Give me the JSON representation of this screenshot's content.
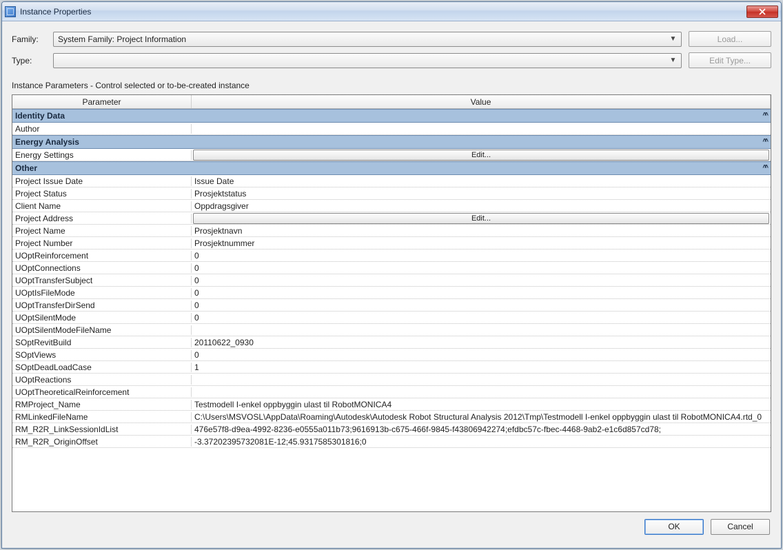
{
  "window": {
    "title": "Instance Properties"
  },
  "labels": {
    "family": "Family:",
    "type": "Type:",
    "load": "Load...",
    "edit_type": "Edit Type...",
    "subhead": "Instance Parameters - Control selected or to-be-created instance",
    "col_param": "Parameter",
    "col_value": "Value",
    "edit_btn": "Edit...",
    "ok": "OK",
    "cancel": "Cancel"
  },
  "family_value": "System Family: Project Information",
  "type_value": "",
  "groups": {
    "identity": "Identity Data",
    "energy": "Energy Analysis",
    "other": "Other"
  },
  "rows": {
    "author_p": "Author",
    "author_v": "",
    "energy_p": "Energy Settings",
    "pid_p": "Project Issue Date",
    "pid_v": "Issue Date",
    "pstatus_p": "Project Status",
    "pstatus_v": "Prosjektstatus",
    "client_p": "Client Name",
    "client_v": "Oppdragsgiver",
    "paddr_p": "Project Address",
    "pname_p": "Project Name",
    "pname_v": "Prosjektnavn",
    "pnum_p": "Project Number",
    "pnum_v": "Prosjektnummer",
    "ureinf_p": "UOptReinforcement",
    "ureinf_v": "0",
    "uconn_p": "UOptConnections",
    "uconn_v": "0",
    "utsub_p": "UOptTransferSubject",
    "utsub_v": "0",
    "ufile_p": "UOptIsFileMode",
    "ufile_v": "0",
    "utdir_p": "UOptTransferDirSend",
    "utdir_v": "0",
    "usilent_p": "UOptSilentMode",
    "usilent_v": "0",
    "usilentf_p": "UOptSilentModeFileName",
    "usilentf_v": "",
    "srevit_p": "SOptRevitBuild",
    "srevit_v": "20110622_0930",
    "sviews_p": "SOptViews",
    "sviews_v": "0",
    "sdead_p": "SOptDeadLoadCase",
    "sdead_v": "1",
    "ureact_p": "UOptReactions",
    "ureact_v": "",
    "utheor_p": "UOptTheoreticalReinforcement",
    "utheor_v": "",
    "rmproj_p": "RMProject_Name",
    "rmproj_v": "Testmodell I-enkel oppbyggin ulast til RobotMONICA4",
    "rmlink_p": "RMLinkedFileName",
    "rmlink_v": "C:\\Users\\MSVOSL\\AppData\\Roaming\\Autodesk\\Autodesk Robot Structural Analysis 2012\\Tmp\\Testmodell I-enkel oppbyggin ulast til RobotMONICA4.rtd_0",
    "rmr2r_p": "RM_R2R_LinkSessionIdList",
    "rmr2r_v": "476e57f8-d9ea-4992-8236-e0555a011b73;9616913b-c675-466f-9845-f43806942274;efdbc57c-fbec-4468-9ab2-e1c6d857cd78;",
    "rmoff_p": "RM_R2R_OriginOffset",
    "rmoff_v": "-3.37202395732081E-12;45.9317585301816;0"
  }
}
